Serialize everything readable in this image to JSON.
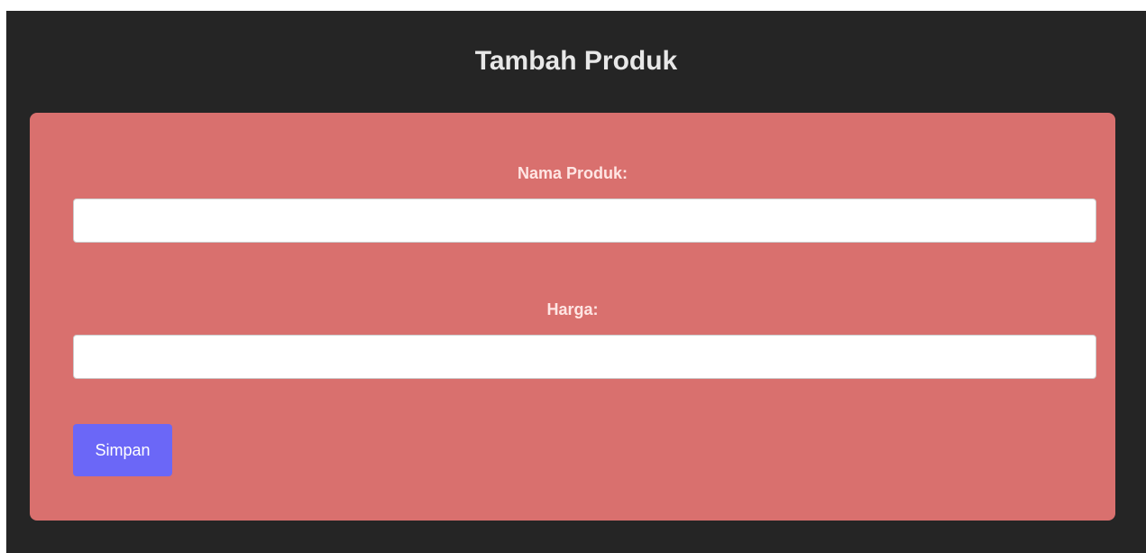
{
  "header": {
    "title": "Tambah Produk"
  },
  "form": {
    "fields": [
      {
        "label": "Nama Produk:",
        "value": "",
        "placeholder": ""
      },
      {
        "label": "Harga:",
        "value": "",
        "placeholder": ""
      }
    ],
    "submit_label": "Simpan"
  },
  "colors": {
    "page_background": "#252525",
    "card_background": "#d9706e",
    "button_background": "#6b67f7",
    "title_text": "#e8e8e8",
    "label_text": "#ffe6e4"
  }
}
